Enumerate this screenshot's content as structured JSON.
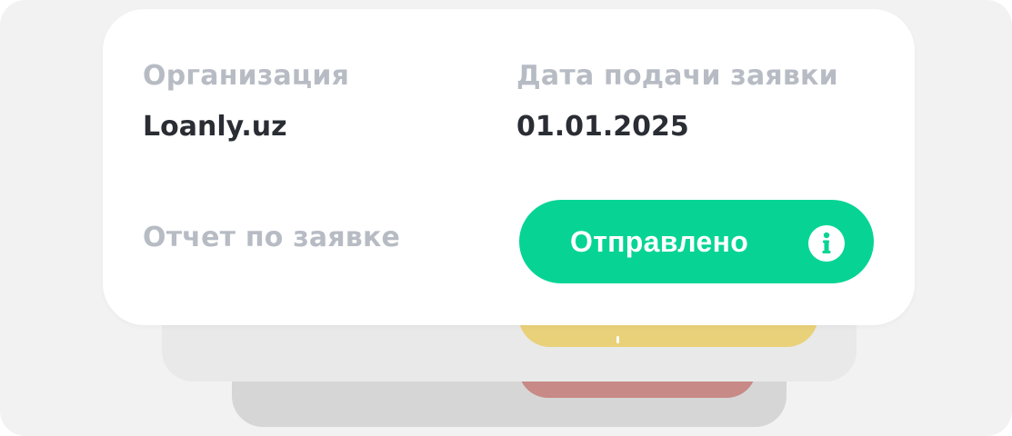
{
  "application": {
    "organization_label": "Организация",
    "organization_value": "Loanly.uz",
    "date_label": "Дата подачи заявки",
    "date_value": "01.01.2025",
    "report_label": "Отчет по заявке",
    "status": {
      "label": "Отправлено",
      "color": "#07d494",
      "icon": "info-icon"
    }
  },
  "stacked_cards": {
    "middle_status_color": "#e9d17a",
    "back_status_color": "#c78a86"
  }
}
